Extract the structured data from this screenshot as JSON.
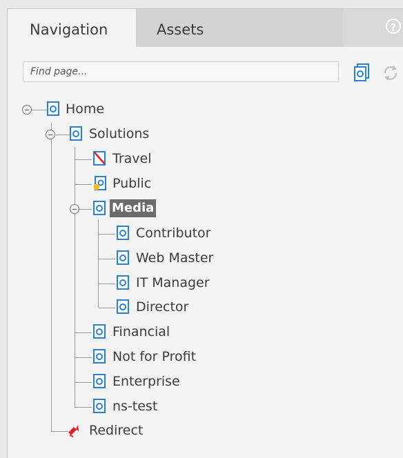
{
  "tabs": [
    {
      "label": "Navigation",
      "active": true
    },
    {
      "label": "Assets",
      "active": false
    }
  ],
  "help_icon": "help-icon",
  "search": {
    "placeholder": "Find page..."
  },
  "toolbar": {
    "new_page_icon": "page-add-icon",
    "refresh_icon": "refresh-icon"
  },
  "tree": {
    "home": "Home",
    "solutions": "Solutions",
    "travel": "Travel",
    "public": "Public",
    "media": "Media",
    "contributor": "Contributor",
    "web_master": "Web Master",
    "it_manager": "IT Manager",
    "director": "Director",
    "financial": "Financial",
    "not_for_profit": "Not for Profit",
    "enterprise": "Enterprise",
    "ns_test": "ns-test",
    "redirect": "Redirect"
  },
  "selected_node": "Media",
  "colors": {
    "accent_blue": "#2a7fd0",
    "selected_bg": "#6b6b6b",
    "redirect_red": "#d9232b"
  }
}
